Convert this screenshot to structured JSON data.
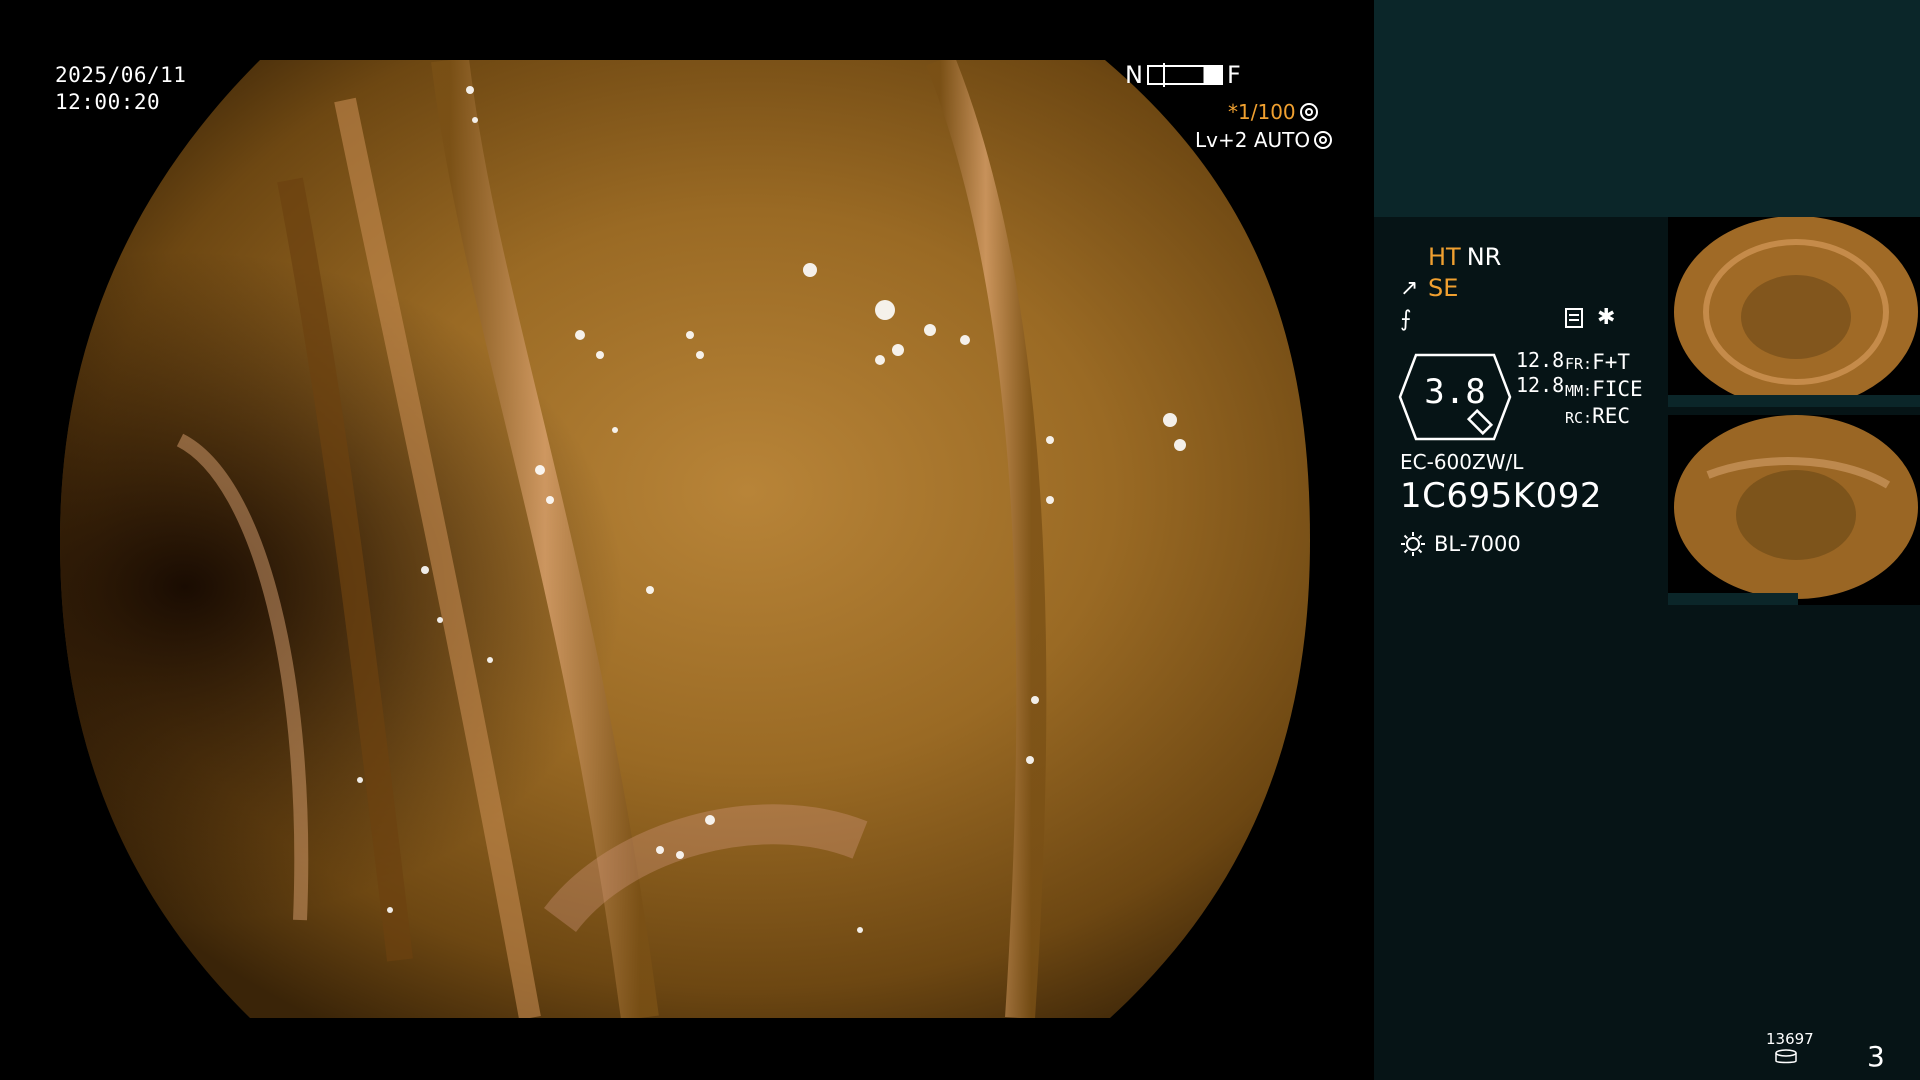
{
  "overlay": {
    "date": "2025/06/11",
    "time": "12:00:20",
    "scale_near": "N",
    "scale_far": "F",
    "shutter": "*1/100",
    "iris": "Lv+2 AUTO"
  },
  "panel": {
    "mode_ht": "HT",
    "mode_nr": "NR",
    "mode_se": "SE",
    "zoom": "3.8",
    "stats": [
      "12.8",
      "12.8"
    ],
    "labels": [
      {
        "key": "FR:",
        "value": "F+T"
      },
      {
        "key": "MM:",
        "value": "FICE"
      },
      {
        "key": "RC:",
        "value": "REC"
      }
    ],
    "scope_model": "EC-600ZW/L",
    "scope_serial": "1C695K092",
    "light_source": "BL-7000",
    "image_count": "13697",
    "page_number": "3"
  },
  "colors": {
    "accent_orange": "#f0a030",
    "panel_top": "#0b2629",
    "panel_bottom": "#061416"
  },
  "icons": [
    "shutter-icon",
    "iris-icon",
    "fork-icon",
    "snapshot-icon",
    "star-icon",
    "magnifier-icon",
    "sun-icon",
    "disk-icon"
  ]
}
